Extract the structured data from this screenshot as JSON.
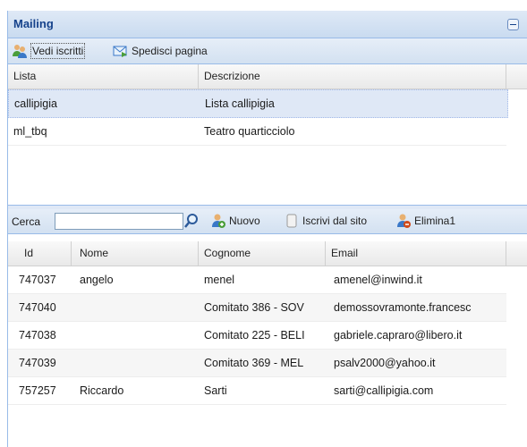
{
  "panel": {
    "title": "Mailing"
  },
  "toolbar": {
    "view_label": "Vedi iscritti",
    "send_label": "Spedisci pagina"
  },
  "lists": {
    "columns": [
      "Lista",
      "Descrizione"
    ],
    "rows": [
      {
        "lista": "callipigia",
        "descrizione": "Lista callipigia"
      },
      {
        "lista": "ml_tbq",
        "descrizione": "Teatro quarticciolo"
      }
    ]
  },
  "search": {
    "label": "Cerca",
    "value": "",
    "placeholder": ""
  },
  "actions": {
    "new_label": "Nuovo",
    "subscribe_label": "Iscrivi dal sito",
    "delete_label": "Elimina1"
  },
  "subscribers": {
    "columns": [
      "Id",
      "Nome",
      "Cognome",
      "Email"
    ],
    "rows": [
      {
        "id": "747037",
        "nome": "angelo",
        "cognome": "menel",
        "email": "amenel@inwind.it"
      },
      {
        "id": "747040",
        "nome": "",
        "cognome": "Comitato 386 - SOV",
        "email": "demossovramonte.francesc"
      },
      {
        "id": "747038",
        "nome": "",
        "cognome": "Comitato 225 - BELI",
        "email": "gabriele.capraro@libero.it"
      },
      {
        "id": "747039",
        "nome": "",
        "cognome": "Comitato 369 - MEL",
        "email": "psalv2000@yahoo.it"
      },
      {
        "id": "757257",
        "nome": "Riccardo",
        "cognome": "Sarti",
        "email": "sarti@callipigia.com"
      }
    ]
  },
  "colors": {
    "accent": "#15428b",
    "border": "#99bbe8",
    "selected": "#dfe8f6"
  }
}
